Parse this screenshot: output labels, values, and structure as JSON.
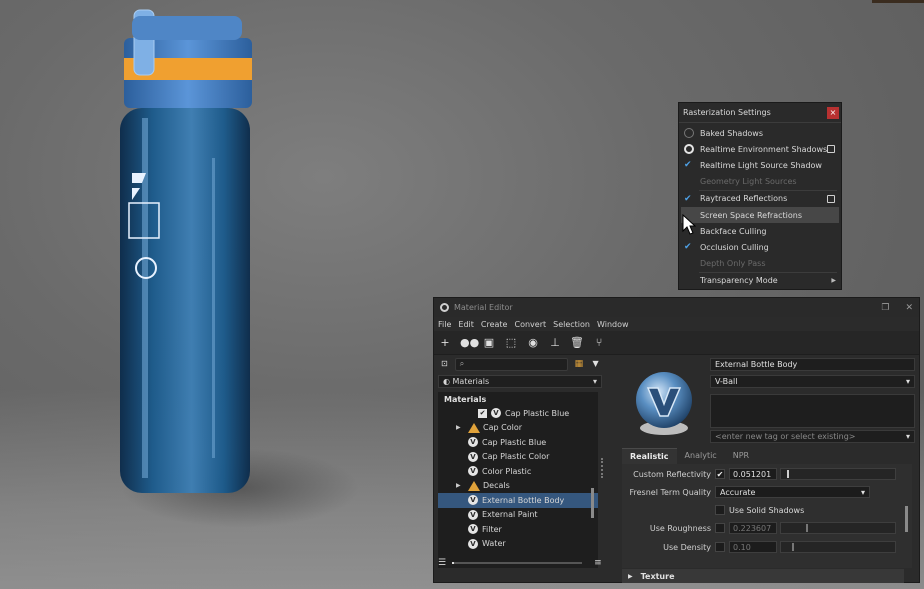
{
  "raster": {
    "title": "Rasterization Settings",
    "close": "×",
    "items": [
      {
        "label": "Baked Shadows",
        "mark": "radio",
        "checked": false
      },
      {
        "label": "Realtime Environment Shadows",
        "mark": "radio",
        "checked": true
      },
      {
        "label": "Realtime Light Source Shadow",
        "mark": "check",
        "checked": true
      },
      {
        "label": "Geometry Light Sources",
        "disabled": true
      },
      {
        "label": "Raytraced Reflections",
        "mark": "check",
        "checked": true
      },
      {
        "label": "Screen Space Refractions",
        "hover": true
      },
      {
        "label": "Backface Culling"
      },
      {
        "label": "Occlusion Culling",
        "mark": "check",
        "checked": true
      },
      {
        "label": "Depth Only Pass",
        "disabled": true
      },
      {
        "label": "Transparency Mode",
        "submenu": true
      }
    ]
  },
  "editor": {
    "title": "Material Editor",
    "window_buttons": [
      "❐",
      "✕"
    ],
    "menu": [
      "File",
      "Edit",
      "Create",
      "Convert",
      "Selection",
      "Window"
    ],
    "toolbar_icons": [
      "add-icon",
      "materials-icon",
      "graph-icon",
      "select-icon",
      "assign-icon",
      "clean-icon",
      "delete-icon",
      "share-icon"
    ],
    "filter_dropdown": "Materials",
    "tree_header": "Materials",
    "tree": [
      {
        "label": "Cap Plastic Blue",
        "type": "checked-v",
        "indent": 2
      },
      {
        "label": "Cap Color",
        "type": "group",
        "indent": 1
      },
      {
        "label": "Cap Plastic Blue",
        "type": "v",
        "indent": 1
      },
      {
        "label": "Cap Plastic Color",
        "type": "v",
        "indent": 1
      },
      {
        "label": "Color Plastic",
        "type": "v",
        "indent": 1
      },
      {
        "label": "Decals",
        "type": "group",
        "indent": 1
      },
      {
        "label": "External Bottle Body",
        "type": "v",
        "indent": 1,
        "selected": true
      },
      {
        "label": "External Paint",
        "type": "v",
        "indent": 1
      },
      {
        "label": "Filter",
        "type": "v",
        "indent": 1
      },
      {
        "label": "Water",
        "type": "v",
        "indent": 1
      }
    ],
    "material_name": "External Bottle Body",
    "shader": "V-Ball",
    "tag_placeholder": "<enter new tag or select existing>",
    "tabs": [
      "Realistic",
      "Analytic",
      "NPR"
    ],
    "active_tab": "Realistic",
    "props": {
      "custom_reflectivity": {
        "label": "Custom Reflectivity",
        "value": "0.051201",
        "level": 0.05
      },
      "fresnel": {
        "label": "Fresnel Term Quality",
        "value": "Accurate"
      },
      "solid_shadows": {
        "label": "Use Solid Shadows"
      },
      "roughness": {
        "label": "Use Roughness",
        "value": "0.223607",
        "level": 0.22
      },
      "density": {
        "label": "Use Density",
        "value": "0.10",
        "level": 0.1
      }
    },
    "texture_section": "Texture"
  }
}
